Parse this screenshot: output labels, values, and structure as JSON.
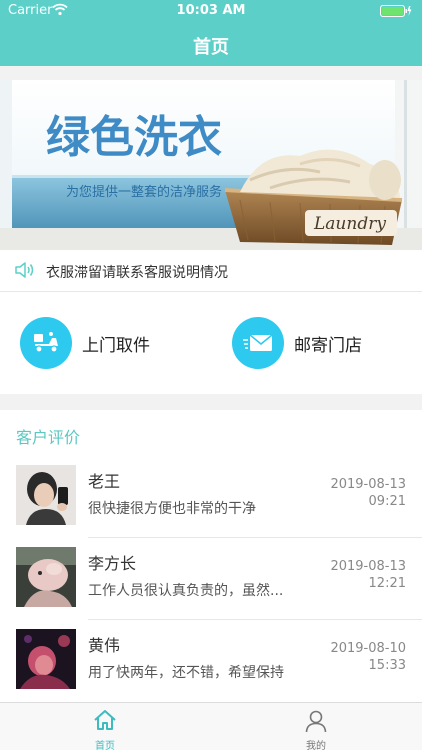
{
  "status_bar": {
    "carrier": "Carrier",
    "time": "10:03 AM",
    "wifi_icon": "wifi-icon",
    "battery_icon": "battery-icon"
  },
  "nav": {
    "title": "首页"
  },
  "banner": {
    "headline": "绿色洗衣",
    "subtitle": "为您提供一整套的洁净服务",
    "script_text": "Laundry"
  },
  "notice": {
    "text": "衣服滞留请联系客服说明情况",
    "icon": "speaker-icon"
  },
  "actions": [
    {
      "label": "上门取件",
      "icon": "delivery-scooter-icon"
    },
    {
      "label": "邮寄门店",
      "icon": "mail-envelope-icon"
    }
  ],
  "reviews": {
    "heading": "客户评价",
    "items": [
      {
        "name": "老王",
        "comment": "很快捷很方便也非常的干净",
        "date": "2019-08-13",
        "time": "09:21"
      },
      {
        "name": "李方长",
        "comment": "工作人员很认真负责的，虽然...",
        "date": "2019-08-13",
        "time": "12:21"
      },
      {
        "name": "黄伟",
        "comment": "用了快两年，还不错，希望保持",
        "date": "2019-08-10",
        "time": "15:33"
      }
    ]
  },
  "tabbar": {
    "tabs": [
      {
        "label": "首页",
        "icon": "home-icon",
        "active": true
      },
      {
        "label": "我的",
        "icon": "user-icon",
        "active": false
      }
    ]
  },
  "colors": {
    "primary": "#5cd0c8",
    "action_circle": "#2ec9ee",
    "heading": "#5cc8c2",
    "tab_active": "#3dbcc0",
    "tab_inactive": "#777777"
  }
}
